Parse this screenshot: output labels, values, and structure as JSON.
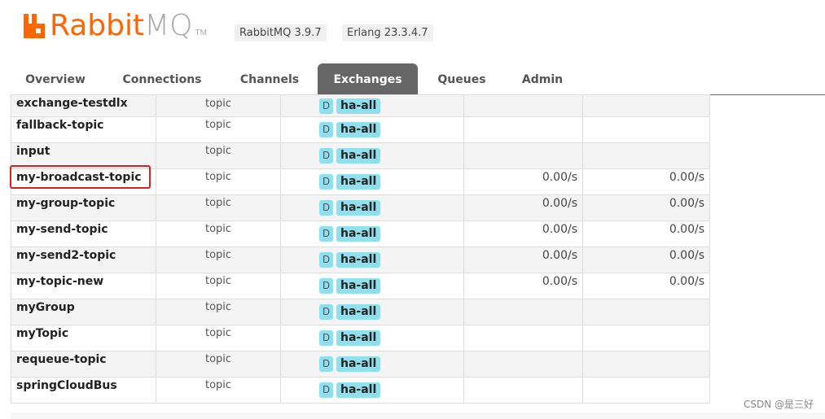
{
  "header": {
    "logo_text_rabbit": "Rabbit",
    "logo_text_mq": "MQ",
    "logo_tm": "TM",
    "rabbitmq_version": "RabbitMQ 3.9.7",
    "erlang_version": "Erlang 23.3.4.7"
  },
  "tabs": [
    {
      "label": "Overview",
      "active": false
    },
    {
      "label": "Connections",
      "active": false
    },
    {
      "label": "Channels",
      "active": false
    },
    {
      "label": "Exchanges",
      "active": true
    },
    {
      "label": "Queues",
      "active": false
    },
    {
      "label": "Admin",
      "active": false
    }
  ],
  "exchanges": [
    {
      "name": "exchange-testdlx",
      "type": "topic",
      "durable_badge": "D",
      "policy": "ha-all",
      "rate_in": "",
      "rate_out": ""
    },
    {
      "name": "fallback-topic",
      "type": "topic",
      "durable_badge": "D",
      "policy": "ha-all",
      "rate_in": "",
      "rate_out": ""
    },
    {
      "name": "input",
      "type": "topic",
      "durable_badge": "D",
      "policy": "ha-all",
      "rate_in": "",
      "rate_out": ""
    },
    {
      "name": "my-broadcast-topic",
      "type": "topic",
      "durable_badge": "D",
      "policy": "ha-all",
      "rate_in": "0.00/s",
      "rate_out": "0.00/s"
    },
    {
      "name": "my-group-topic",
      "type": "topic",
      "durable_badge": "D",
      "policy": "ha-all",
      "rate_in": "0.00/s",
      "rate_out": "0.00/s"
    },
    {
      "name": "my-send-topic",
      "type": "topic",
      "durable_badge": "D",
      "policy": "ha-all",
      "rate_in": "0.00/s",
      "rate_out": "0.00/s"
    },
    {
      "name": "my-send2-topic",
      "type": "topic",
      "durable_badge": "D",
      "policy": "ha-all",
      "rate_in": "0.00/s",
      "rate_out": "0.00/s"
    },
    {
      "name": "my-topic-new",
      "type": "topic",
      "durable_badge": "D",
      "policy": "ha-all",
      "rate_in": "0.00/s",
      "rate_out": "0.00/s"
    },
    {
      "name": "myGroup",
      "type": "topic",
      "durable_badge": "D",
      "policy": "ha-all",
      "rate_in": "",
      "rate_out": ""
    },
    {
      "name": "myTopic",
      "type": "topic",
      "durable_badge": "D",
      "policy": "ha-all",
      "rate_in": "",
      "rate_out": ""
    },
    {
      "name": "requeue-topic",
      "type": "topic",
      "durable_badge": "D",
      "policy": "ha-all",
      "rate_in": "",
      "rate_out": ""
    },
    {
      "name": "springCloudBus",
      "type": "topic",
      "durable_badge": "D",
      "policy": "ha-all",
      "rate_in": "",
      "rate_out": ""
    }
  ],
  "highlighted_exchange": "my-broadcast-topic",
  "watermark": "CSDN @是三好",
  "colors": {
    "brand_orange": "#ff6600",
    "tab_active_bg": "#666666",
    "badge_bg": "#8fdfef",
    "highlight_border": "#e02020"
  }
}
